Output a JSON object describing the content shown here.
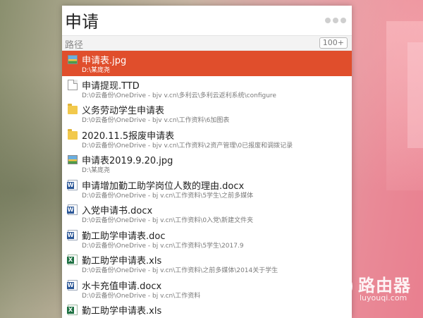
{
  "search": {
    "query": "申请",
    "placeholder": ""
  },
  "header": {
    "path_label": "路径",
    "count": "100+"
  },
  "results": [
    {
      "name": "申请表.jpg",
      "path": "D:\\某庞尧",
      "icon": "image-icon",
      "selected": true
    },
    {
      "name": "申请提现.TTD",
      "path": "D:\\0云备份\\OneDrive - bjv          v.cn\\多利云\\多利云返利系统\\configure",
      "icon": "file-icon"
    },
    {
      "name": "义务劳动学生申请表",
      "path": "D:\\0云备份\\OneDrive - bjv          v.cn\\工作资料\\6加图表",
      "icon": "folder-icon"
    },
    {
      "name": "2020.11.5报废申请表",
      "path": "D:\\0云备份\\OneDrive - bjv          v.cn\\工作资料\\2资产管理\\0已报废和调拨记录",
      "icon": "folder-icon"
    },
    {
      "name": "申请表2019.9.20.jpg",
      "path": "D:\\某庞尧",
      "icon": "image-icon"
    },
    {
      "name": "申请增加勤工助学岗位人数的理由.docx",
      "path": "D:\\0云备份\\OneDrive - bj          v.cn\\工作资料\\5学生\\之前多媒体",
      "icon": "word-icon"
    },
    {
      "name": "入党申请书.docx",
      "path": "D:\\0云备份\\OneDrive - bj          v.cn\\工作资料\\0入党\\新建文件夹",
      "icon": "word-icon"
    },
    {
      "name": "勤工助学申请表.doc",
      "path": "D:\\0云备份\\OneDrive - bj          v.cn\\工作资料\\5学生\\2017.9",
      "icon": "word-icon"
    },
    {
      "name": "勤工助学申请表.xls",
      "path": "D:\\0云备份\\OneDrive - bj          v.cn\\工作资料\\之前多媒体\\2014关于学生",
      "icon": "excel-icon"
    },
    {
      "name": "水卡充值申请.docx",
      "path": "D:\\0云备份\\OneDrive - bj          v.cn\\工作资料",
      "icon": "word-icon"
    },
    {
      "name": "勤工助学申请表.xls",
      "path": "",
      "icon": "excel-icon"
    }
  ],
  "watermark": {
    "title": "路由器",
    "url": "luyouqi.com"
  },
  "colors": {
    "selected": "#e04e2c",
    "accent_text": "#ffffff"
  }
}
